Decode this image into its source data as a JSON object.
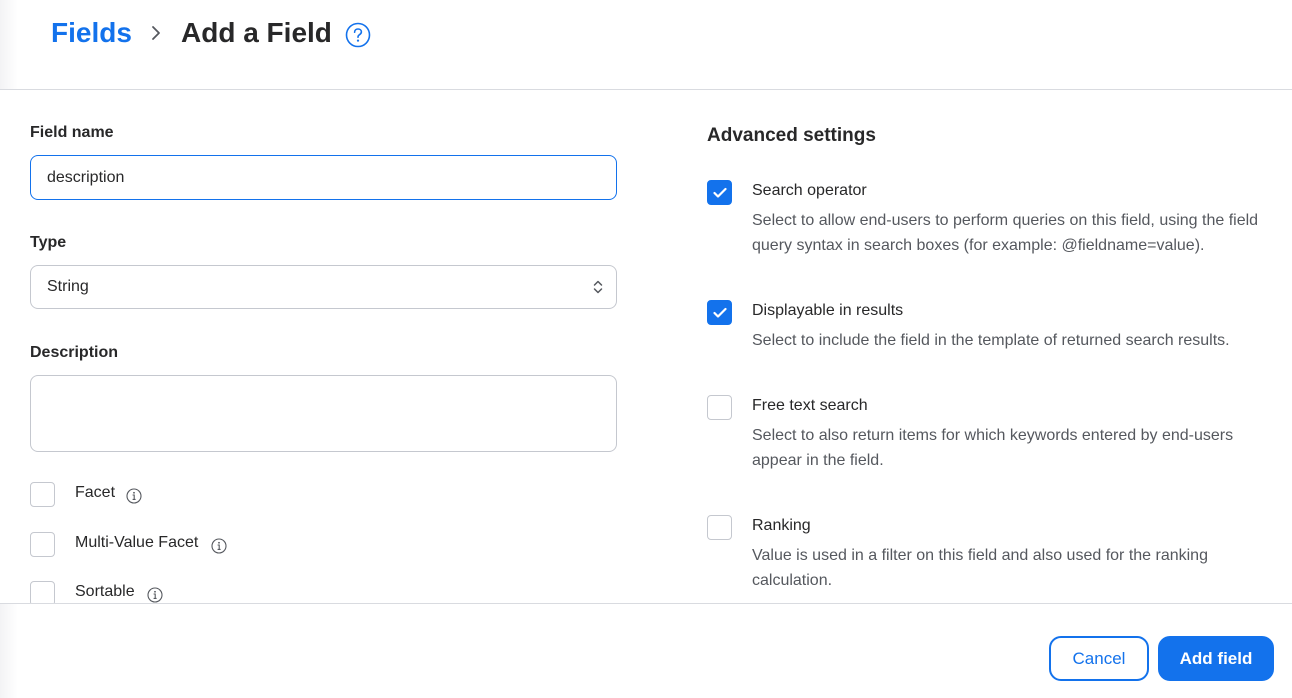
{
  "header": {
    "breadcrumb_parent": "Fields",
    "title": "Add a Field"
  },
  "form": {
    "field_name": {
      "label": "Field name",
      "value": "description"
    },
    "type": {
      "label": "Type",
      "selected": "String"
    },
    "description": {
      "label": "Description",
      "value": ""
    },
    "options": [
      {
        "label": "Facet",
        "checked": false
      },
      {
        "label": "Multi-Value Facet",
        "checked": false
      },
      {
        "label": "Sortable",
        "checked": false
      }
    ]
  },
  "advanced": {
    "title": "Advanced settings",
    "settings": [
      {
        "title": "Search operator",
        "checked": true,
        "desc_line1": "Select to allow end-users to perform queries on this field, using the field",
        "desc_line2": "query syntax in search boxes (for example: @fieldname=value)."
      },
      {
        "title": "Displayable in results",
        "checked": true,
        "desc_line1": "Select to include the field in the template of returned search results.",
        "desc_line2": ""
      },
      {
        "title": "Free text search",
        "checked": false,
        "desc_line1": "Select to also return items for which keywords entered by end-users",
        "desc_line2": "appear in the field."
      },
      {
        "title": "Ranking",
        "checked": false,
        "desc_line1": "Value is used in a filter on this field and also used for the ranking",
        "desc_line2": "calculation."
      }
    ]
  },
  "footer": {
    "cancel_label": "Cancel",
    "add_label": "Add field"
  },
  "colors": {
    "accent": "#1372ec",
    "text": "#282829",
    "muted": "#55585e",
    "border": "#c5c8cf"
  }
}
